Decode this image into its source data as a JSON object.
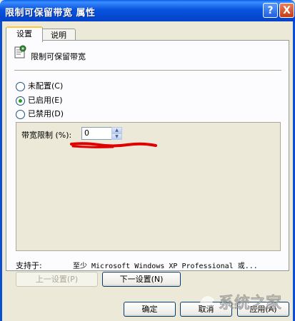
{
  "window": {
    "title": "限制可保留带宽 属性",
    "help_button": "?",
    "close_button": "X"
  },
  "tabs": [
    {
      "label": "设置",
      "active": true
    },
    {
      "label": "说明",
      "active": false
    }
  ],
  "policy": {
    "name": "限制可保留带宽",
    "icon": "policy-setting-icon"
  },
  "radios": [
    {
      "label": "未配置(C)",
      "checked": false
    },
    {
      "label": "已启用(E)",
      "checked": true
    },
    {
      "label": "已禁用(D)",
      "checked": false
    }
  ],
  "options": {
    "bandwidth_label": "带宽限制 (%):",
    "bandwidth_value": "0"
  },
  "supported": {
    "label": "支持于:",
    "value": "至少 Microsoft Windows XP Professional 或..."
  },
  "nav_buttons": {
    "prev": "上一设置(P)",
    "next": "下一设置(N)"
  },
  "dialog_buttons": {
    "ok": "确定",
    "cancel": "取消",
    "apply": "应用(A)"
  },
  "watermark": "系统之家",
  "colors": {
    "titlebar": "#0a54dd",
    "annotation": "#e00000",
    "checked_radio": "#21a121"
  }
}
